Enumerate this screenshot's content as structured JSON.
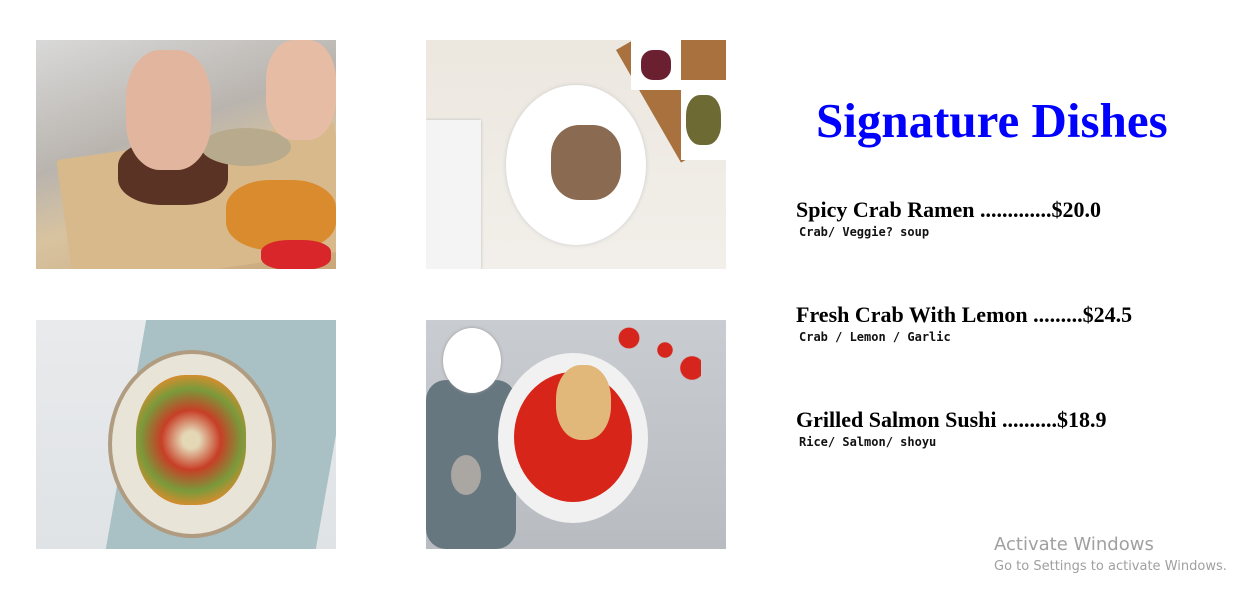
{
  "title": "Signature Dishes",
  "photos": [
    {
      "icon": "steak-photo"
    },
    {
      "icon": "plated-meat-photo"
    },
    {
      "icon": "greek-salad-photo"
    },
    {
      "icon": "tomato-soup-photo"
    }
  ],
  "menu": [
    {
      "name": "Spicy Crab Ramen .............$20.0",
      "desc": "Crab/ Veggie? soup"
    },
    {
      "name": "Fresh Crab With Lemon .........$24.5",
      "desc": "Crab / Lemon / Garlic"
    },
    {
      "name": "Grilled Salmon Sushi ..........$18.9",
      "desc": "Rice/ Salmon/ shoyu"
    }
  ],
  "watermark": {
    "title": "Activate Windows",
    "subtitle": "Go to Settings to activate Windows."
  },
  "colors": {
    "title": "#0000ff"
  }
}
